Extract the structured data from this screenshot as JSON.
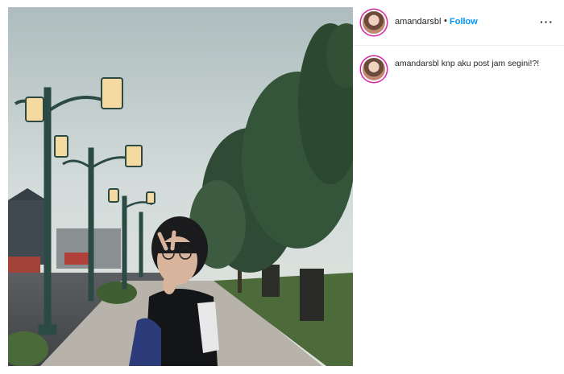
{
  "post": {
    "username": "amandarsbl",
    "separator": "•",
    "follow_label": "Follow",
    "more_icon": "more-options-icon",
    "more_glyph": "···"
  },
  "caption": {
    "username": "amandarsbl",
    "text": "knp aku post jam segini!?!"
  },
  "colors": {
    "follow": "#0095f6",
    "text": "#262626",
    "story_ring": "#d6249f"
  }
}
